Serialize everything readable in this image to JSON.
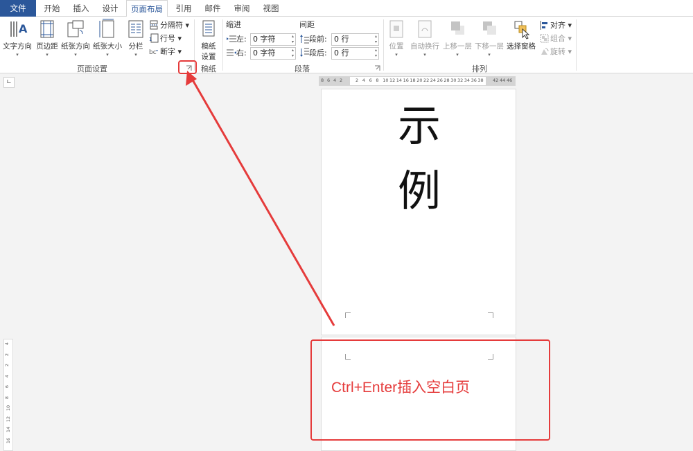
{
  "tabs": [
    "文件",
    "开始",
    "插入",
    "设计",
    "页面布局",
    "引用",
    "邮件",
    "审阅",
    "视图"
  ],
  "active_tab": "页面布局",
  "page_setup": {
    "text_direction": "文字方向",
    "margins": "页边距",
    "orientation": "纸张方向",
    "size": "纸张大小",
    "columns": "分栏",
    "breaks": "分隔符",
    "line_numbers": "行号",
    "hyphenation": "断字",
    "group_label": "页面设置"
  },
  "manuscript": {
    "button_line1": "稿纸",
    "button_line2": "设置",
    "group_label": "稿纸"
  },
  "paragraph": {
    "indent_label": "缩进",
    "spacing_label": "间距",
    "left_label": "左:",
    "left_value": "0 字符",
    "right_label": "右:",
    "right_value": "0 字符",
    "before_label": "段前:",
    "before_value": "0 行",
    "after_label": "段后:",
    "after_value": "0 行",
    "group_label": "段落"
  },
  "arrange": {
    "position": "位置",
    "wrap_text": "自动换行",
    "bring_forward": "上移一层",
    "send_backward": "下移一层",
    "selection_pane": "选择窗格",
    "align": "对齐",
    "group": "组合",
    "rotate": "旋转",
    "group_label": "排列"
  },
  "ruler": {
    "left_ticks": [
      "8",
      "6",
      "4",
      "2"
    ],
    "right_ticks": [
      "2",
      "4",
      "6",
      "8",
      "10",
      "12",
      "14",
      "16",
      "18",
      "20",
      "22",
      "24",
      "26",
      "28",
      "30",
      "32",
      "34",
      "36",
      "38"
    ],
    "end_ticks": [
      "42",
      "44",
      "46"
    ],
    "vertical_ticks": [
      "4",
      "2",
      "2",
      "4",
      "6",
      "8",
      "10",
      "12",
      "14",
      "16"
    ]
  },
  "document": {
    "char1": "示",
    "char2": "例"
  },
  "annotation": {
    "text": "Ctrl+Enter插入空白页",
    "color": "#e53b3b"
  },
  "colors": {
    "file_tab": "#2b579a",
    "accent": "#2b579a",
    "annotation_red": "#e53b3b"
  }
}
